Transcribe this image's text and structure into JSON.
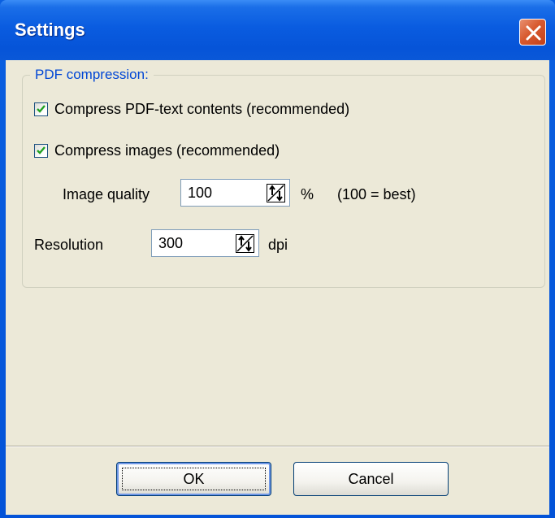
{
  "window": {
    "title": "Settings"
  },
  "group": {
    "legend": "PDF compression:",
    "compress_text": {
      "label": "Compress PDF-text contents (recommended)",
      "checked": true
    },
    "compress_images": {
      "label": "Compress images (recommended)",
      "checked": true
    },
    "image_quality": {
      "label": "Image quality",
      "value": "100",
      "unit": "%",
      "hint": "(100 = best)"
    },
    "resolution": {
      "label": "Resolution",
      "value": "300",
      "unit": "dpi"
    }
  },
  "buttons": {
    "ok": "OK",
    "cancel": "Cancel"
  },
  "icons": {
    "close": "close-icon",
    "check": "checkmark-icon",
    "spin": "spin-arrows-icon"
  },
  "colors": {
    "titlebar": "#0a5ce0",
    "close_button": "#d85a30",
    "legend_text": "#0046d5",
    "dialog_bg": "#ece9d8",
    "checkmark": "#21a121"
  }
}
